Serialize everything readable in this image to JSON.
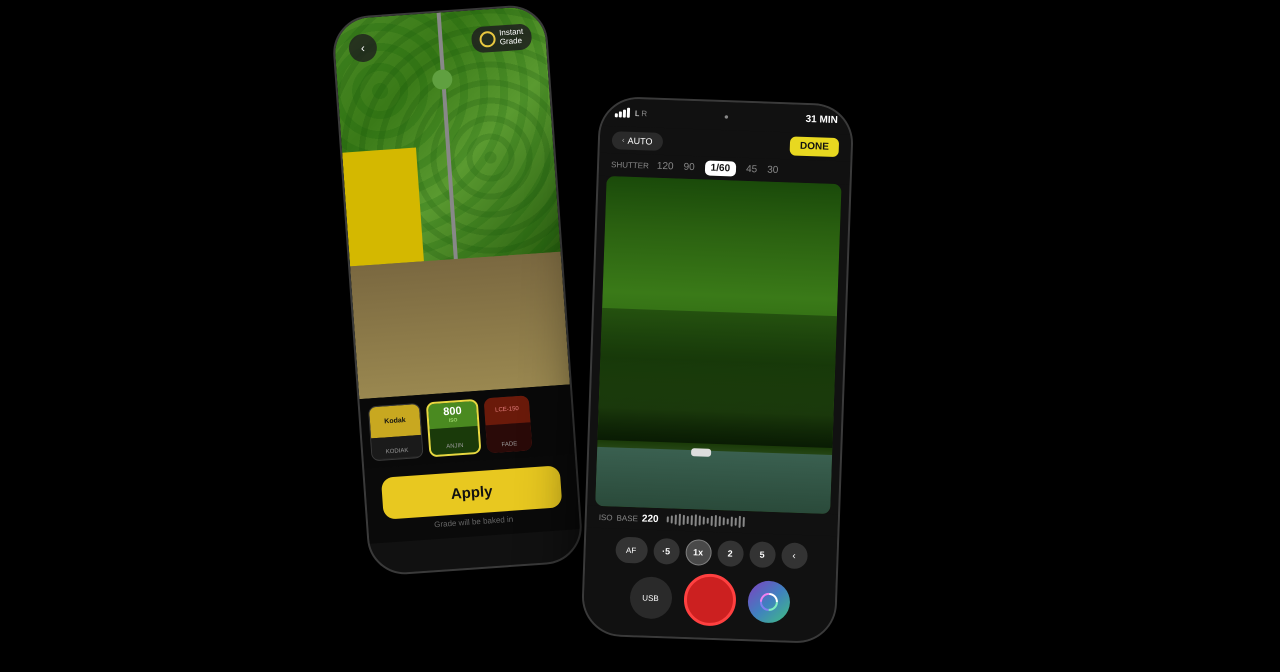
{
  "phone1": {
    "back_label": "‹",
    "instant_grade_label": "Instant\nGrade",
    "film_cards": [
      {
        "id": "kodiak",
        "top_label": "Kodak",
        "name": "KODIAK"
      },
      {
        "id": "anjin",
        "number": "800",
        "iso_label": "ISO",
        "name": "ANJIN"
      },
      {
        "id": "fade",
        "top_label": "LCE-150",
        "name": "FADE"
      }
    ],
    "apply_label": "Apply",
    "apply_hint": "Grade will be baked in"
  },
  "phone2": {
    "time": "31 MIN",
    "auto_label": "AUTO",
    "done_label": "DONE",
    "shutter_label": "SHUTTER",
    "shutter_values": [
      "120",
      "90",
      "1/60",
      "45",
      "30"
    ],
    "shutter_active": "1/60",
    "iso_label": "ISO",
    "iso_base_label": "BASE",
    "iso_value": "220",
    "af_label": "AF",
    "zoom_options": [
      "·5",
      "1x",
      "2",
      "5"
    ],
    "zoom_active": "1x",
    "back_arrow": "‹",
    "usb_label": "USB"
  }
}
